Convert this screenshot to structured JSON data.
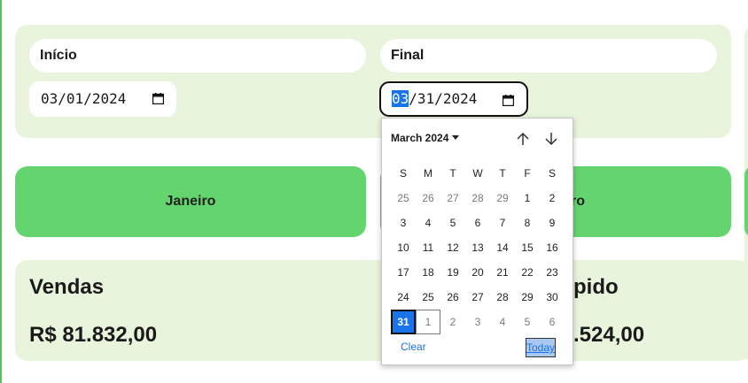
{
  "filters": {
    "start_label": "Início",
    "end_label": "Final",
    "start": {
      "month": "03",
      "day": "01",
      "year": "2024"
    },
    "end": {
      "month": "03",
      "day": "31",
      "year": "2024"
    }
  },
  "months": [
    "Janeiro",
    "ro"
  ],
  "stats": {
    "sales": {
      "title": "Vendas",
      "value": "R$ 81.832,00"
    },
    "net": {
      "title": "pido",
      "value": ".524,00"
    }
  },
  "datepicker": {
    "month_label": "March 2024",
    "weekdays": [
      "S",
      "M",
      "T",
      "W",
      "T",
      "F",
      "S"
    ],
    "weeks": [
      [
        "25",
        "26",
        "27",
        "28",
        "29",
        "1",
        "2"
      ],
      [
        "3",
        "4",
        "5",
        "6",
        "7",
        "8",
        "9"
      ],
      [
        "10",
        "11",
        "12",
        "13",
        "14",
        "15",
        "16"
      ],
      [
        "17",
        "18",
        "19",
        "20",
        "21",
        "22",
        "23"
      ],
      [
        "24",
        "25",
        "26",
        "27",
        "28",
        "29",
        "30"
      ],
      [
        "31",
        "1",
        "2",
        "3",
        "4",
        "5",
        "6"
      ]
    ],
    "selected_day": "31",
    "clear_label": "Clear",
    "today_label": "Today"
  },
  "icons": {
    "calendar": "calendar-icon",
    "prev": "arrow-up-icon",
    "next": "arrow-down-icon",
    "dropdown": "caret-down-icon"
  },
  "colors": {
    "panel_bg": "#e8f4dc",
    "month_button": "#64d46e",
    "accent": "#1a73e8"
  }
}
